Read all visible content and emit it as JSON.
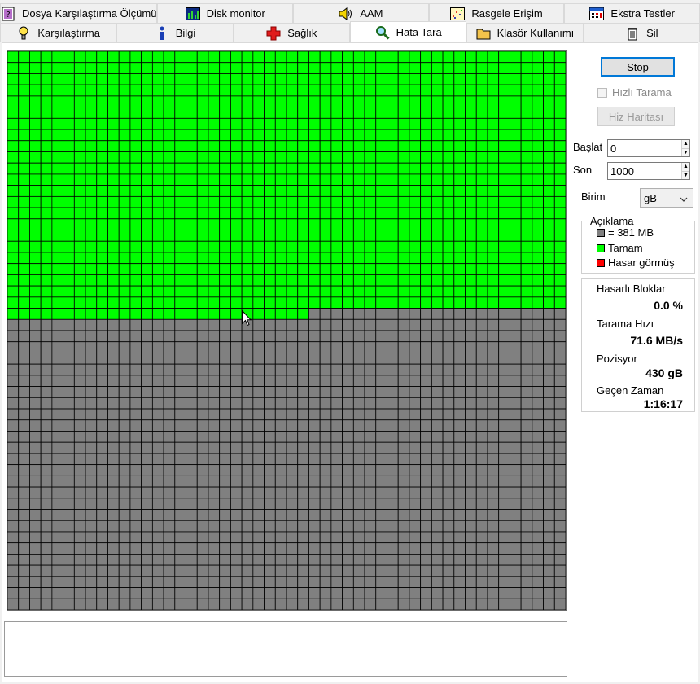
{
  "tabs_row1": [
    {
      "label": "Dosya Karşılaştırma Ölçümü",
      "icon": "file-benchmark-icon"
    },
    {
      "label": "Disk monitor",
      "icon": "disk-monitor-chart-icon"
    },
    {
      "label": "AAM",
      "icon": "speaker-icon"
    },
    {
      "label": "Rasgele Erişim",
      "icon": "random-access-icon"
    },
    {
      "label": "Ekstra Testler",
      "icon": "extra-tests-icon"
    }
  ],
  "tabs_row2": [
    {
      "label": "Karşılaştırma",
      "icon": "benchmark-bulb-icon"
    },
    {
      "label": "Bilgi",
      "icon": "info-icon"
    },
    {
      "label": "Sağlık",
      "icon": "health-cross-icon"
    },
    {
      "label": "Hata Tara",
      "icon": "magnifier-icon",
      "active": true
    },
    {
      "label": "Klasör Kullanımı",
      "icon": "folder-icon"
    },
    {
      "label": "Sil",
      "icon": "trash-icon"
    }
  ],
  "controls": {
    "stop_label": "Stop",
    "quick_scan_label": "Hızlı Tarama",
    "quick_scan_checked": false,
    "speed_map_label": "Hiz Haritası",
    "start_label": "Başlat",
    "start_value": "0",
    "end_label": "Son",
    "end_value": "1000",
    "unit_label": "Birim",
    "unit_value": "gB"
  },
  "legend": {
    "title": "Açıklama",
    "items": [
      {
        "label": "= 381 MB",
        "color": "#808080"
      },
      {
        "label": "Tamam",
        "color": "#00ff00"
      },
      {
        "label": "Hasar görmüş",
        "color": "#ff0000"
      }
    ]
  },
  "stats": {
    "damaged_label": "Hasarlı Bloklar",
    "damaged_value": "0.0 %",
    "speed_label": "Tarama Hızı",
    "speed_value": "71.6 MB/s",
    "position_label": "Pozisyor",
    "position_value": "430 gB",
    "elapsed_label": "Geçen Zaman",
    "elapsed_value": "1:16:17"
  },
  "scan_grid": {
    "columns": 50,
    "rows": 50,
    "ok_blocks": 1177,
    "ok_color": "#00ff00",
    "pending_color": "#808080",
    "damaged_color": "#ff0000",
    "line_color": "#000000"
  },
  "log_text": ""
}
